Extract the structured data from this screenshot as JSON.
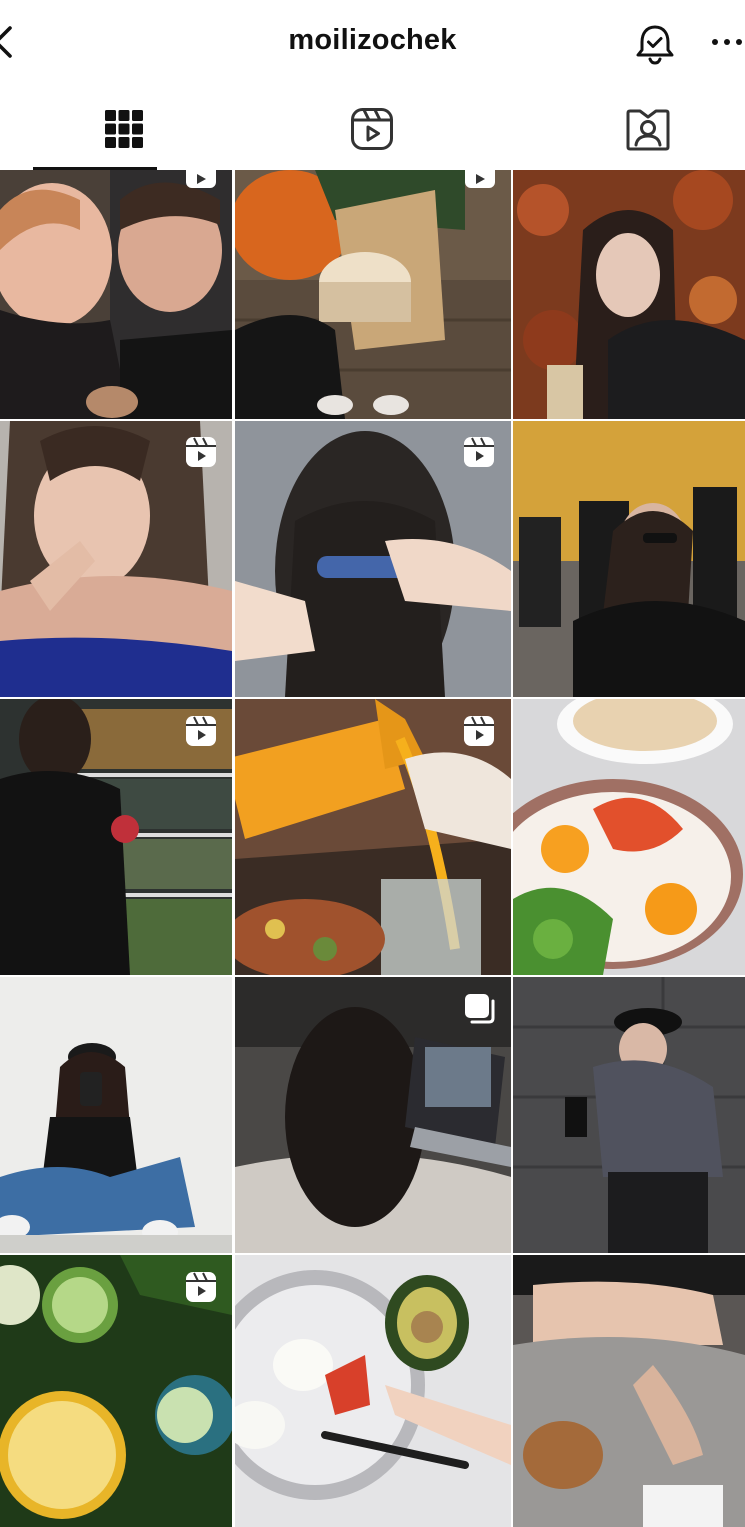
{
  "header": {
    "username": "moilizochek",
    "back_icon": "chevron-left-icon",
    "notifications_icon": "bell-check-icon",
    "more_icon": "more-horizontal-icon"
  },
  "tabs": [
    {
      "name": "posts",
      "icon": "grid-icon",
      "selected": true
    },
    {
      "name": "reels",
      "icon": "reels-icon",
      "selected": false
    },
    {
      "name": "tagged",
      "icon": "tagged-person-icon",
      "selected": false
    }
  ],
  "posts": [
    {
      "type": "reel",
      "subject": "couple-selfie-coffee"
    },
    {
      "type": "reel",
      "subject": "coffee-cup-pumpkin"
    },
    {
      "type": "photo",
      "subject": "girl-autumn-leaves"
    },
    {
      "type": "reel",
      "subject": "girl-wet-hair"
    },
    {
      "type": "reel",
      "subject": "hair-clip"
    },
    {
      "type": "photo",
      "subject": "girl-sunglasses-building"
    },
    {
      "type": "reel",
      "subject": "supermarket-shelf"
    },
    {
      "type": "reel",
      "subject": "orange-juice-pour"
    },
    {
      "type": "photo",
      "subject": "breakfast-eggs-salmon"
    },
    {
      "type": "photo",
      "subject": "girl-cap-sitting"
    },
    {
      "type": "carousel",
      "subject": "girl-laptop-bed"
    },
    {
      "type": "photo",
      "subject": "girl-coffee-grey-wall"
    },
    {
      "type": "reel",
      "subject": "cucumber-lemon-dill"
    },
    {
      "type": "photo",
      "subject": "plate-avocado-egg"
    },
    {
      "type": "photo",
      "subject": "girl-grey-pants-drink"
    }
  ],
  "colors": {
    "text": "#111111",
    "separator": "#ffffff"
  }
}
